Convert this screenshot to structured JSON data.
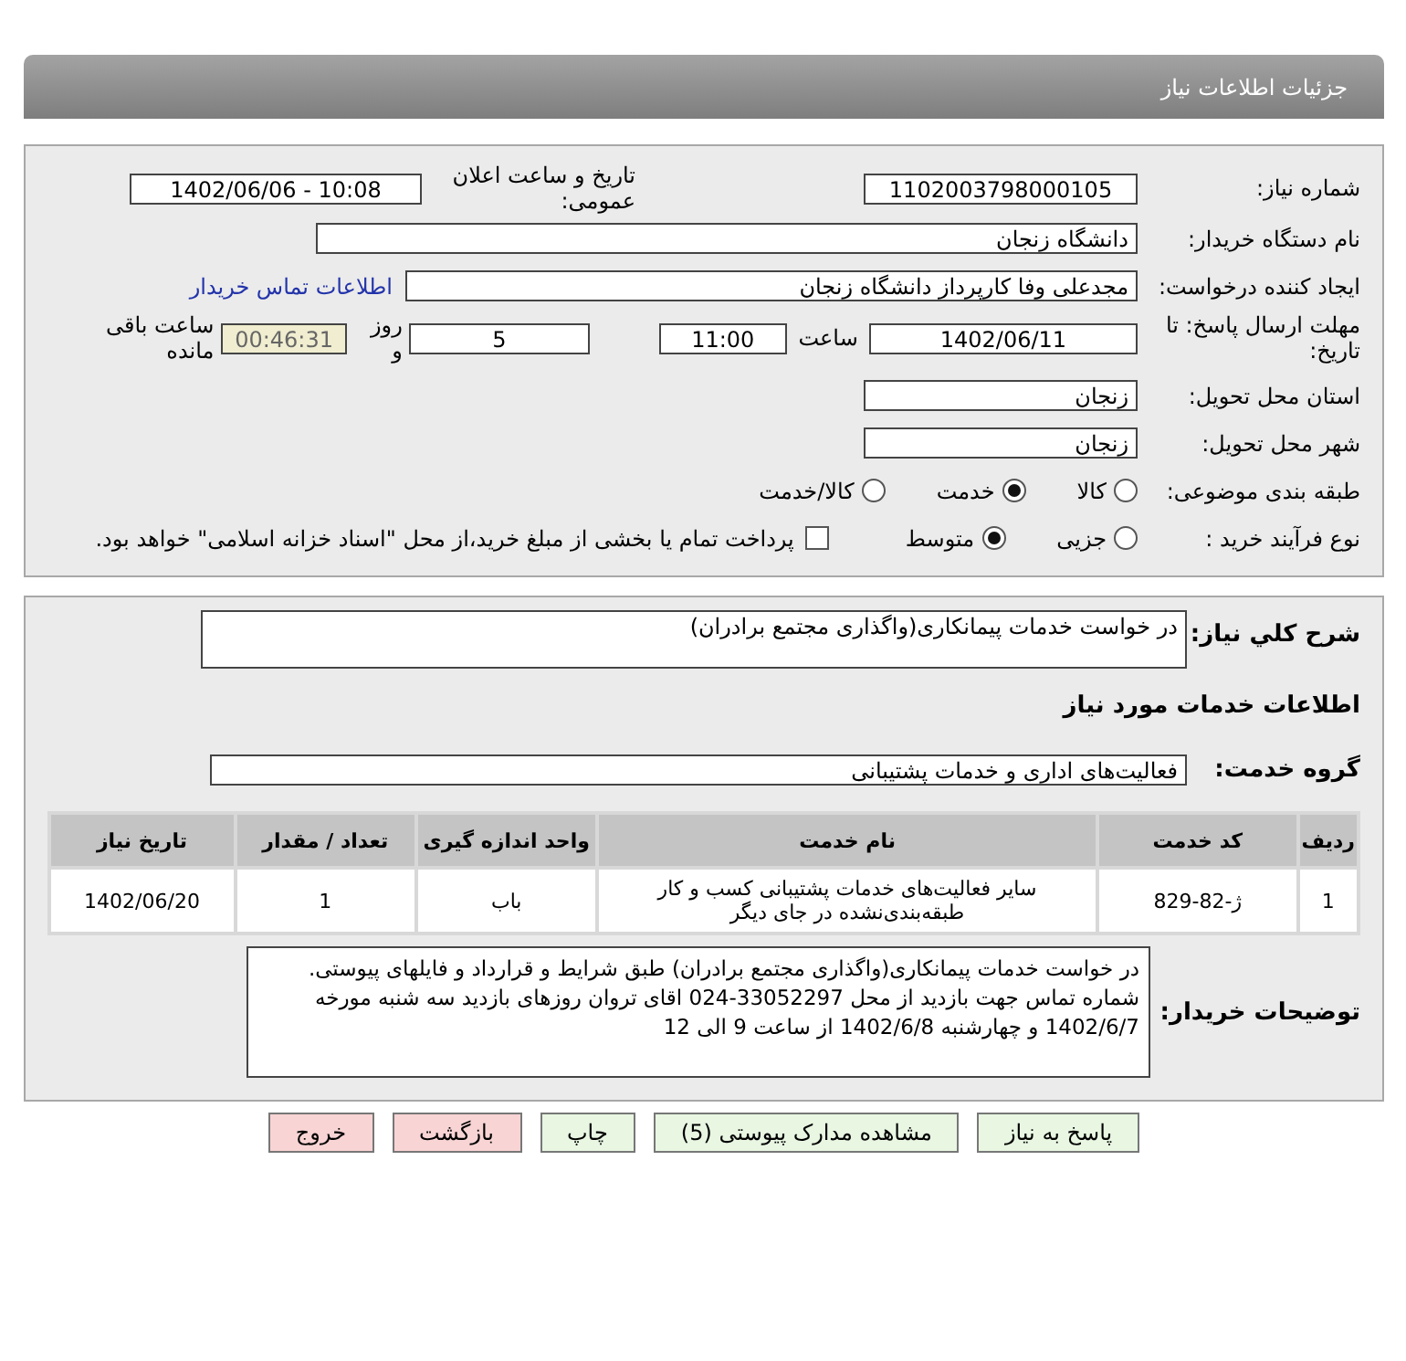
{
  "title": "جزئیات اطلاعات نیاز",
  "need_number": {
    "label": "شماره نیاز:",
    "value": "1102003798000105"
  },
  "announce": {
    "label": "تاریخ و ساعت اعلان عمومی:",
    "value": "1402/06/06 - 10:08"
  },
  "buyer_org": {
    "label": "نام دستگاه خریدار:",
    "value": "دانشگاه زنجان"
  },
  "requester": {
    "label": "ایجاد کننده درخواست:",
    "value": "مجدعلی وفا کارپرداز دانشگاه زنجان",
    "link": "اطلاعات تماس خریدار"
  },
  "deadline": {
    "label": "مهلت ارسال پاسخ: تا تاریخ:",
    "date": "1402/06/11",
    "time_label": "ساعت",
    "time": "11:00",
    "days": "5",
    "days_label": "روز و",
    "remaining": "00:46:31",
    "remaining_label": "ساعت باقی مانده"
  },
  "province": {
    "label": "استان محل تحویل:",
    "value": "زنجان"
  },
  "city": {
    "label": "شهر محل تحویل:",
    "value": "زنجان"
  },
  "category": {
    "label": "طبقه بندی موضوعی:",
    "options": [
      {
        "label": "کالا",
        "selected": false
      },
      {
        "label": "خدمت",
        "selected": true
      },
      {
        "label": "کالا/خدمت",
        "selected": false
      }
    ]
  },
  "purchase_type": {
    "label": "نوع فرآیند خرید :",
    "options": [
      {
        "label": "جزیی",
        "selected": false
      },
      {
        "label": "متوسط",
        "selected": true
      }
    ],
    "checkbox": {
      "checked": false,
      "text": "پرداخت تمام یا بخشی از مبلغ خرید،از محل \"اسناد خزانه اسلامی\" خواهد بود."
    }
  },
  "description": {
    "label": "شرح کلي نياز:",
    "value": "در خواست خدمات پیمانکاری(واگذاری مجتمع برادران)"
  },
  "services_heading": "اطلاعات خدمات مورد نیاز",
  "service_group": {
    "label": "گروه خدمت:",
    "value": "فعالیت‌های اداری و خدمات پشتیبانی"
  },
  "table": {
    "columns": [
      "ردیف",
      "کد خدمت",
      "نام خدمت",
      "واحد اندازه گیری",
      "تعداد / مقدار",
      "تاریخ نیاز"
    ],
    "rows": [
      [
        "1",
        "ژ-82-829",
        "سایر فعالیت‌های خدمات پشتیبانی کسب و کار طبقه‌بندی‌نشده در جای دیگر",
        "باب",
        "1",
        "1402/06/20"
      ]
    ]
  },
  "buyer_notes": {
    "label": "توضیحات خریدار:",
    "value": "در خواست خدمات پیمانکاری(واگذاری مجتمع برادران) طبق شرایط و قرارداد و فایلهای پیوستی. شماره تماس جهت بازدید از محل 33052297-024 اقای تروان روزهای بازدید سه شنبه مورخه 1402/6/7 و چهارشنبه 1402/6/8 از ساعت 9 الی 12"
  },
  "buttons": [
    {
      "label": "پاسخ به نیاز",
      "kind": "normal"
    },
    {
      "label": "مشاهده مدارک پیوستی (5)",
      "kind": "normal"
    },
    {
      "label": "چاپ",
      "kind": "normal"
    },
    {
      "label": "بازگشت",
      "kind": "danger"
    },
    {
      "label": "خروج",
      "kind": "danger"
    }
  ]
}
